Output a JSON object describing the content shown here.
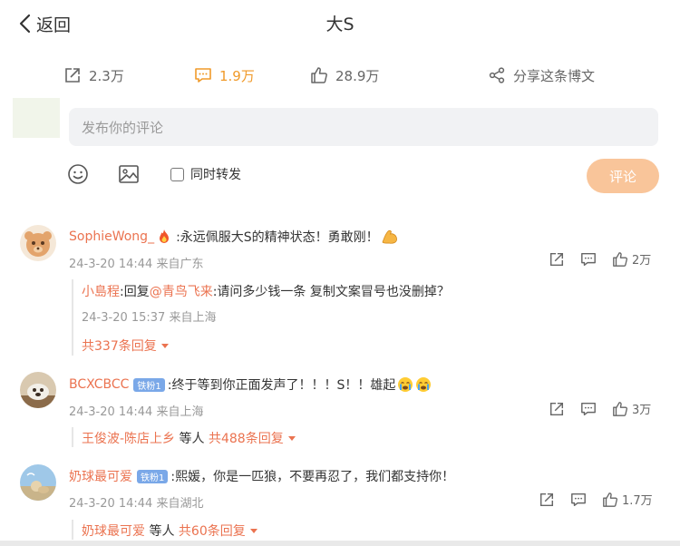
{
  "header": {
    "back_label": "返回",
    "title": "大S"
  },
  "stats": {
    "reposts": "2.3万",
    "comments": "1.9万",
    "likes": "28.9万",
    "share_label": "分享这条博文"
  },
  "composer": {
    "placeholder": "发布你的评论",
    "repost_label": "同时转发",
    "submit_label": "评论"
  },
  "comments": [
    {
      "user": "SophieWong_",
      "text": ":永远佩服大S的精神状态！勇敢刚！",
      "time": "24-3-20 14:44 来自广东",
      "likes": "2万",
      "reply": {
        "user": "小島程",
        "prefix": ":回复",
        "mention": "@青鸟飞来",
        "text": ":请问多少钱一条 复制文案冒号也没删掉？",
        "time": "24-3-20 15:37 来自上海"
      },
      "more": "共337条回复"
    },
    {
      "user": "BCXCBCC",
      "badge": "铁粉1",
      "text": ":终于等到你正面发声了！！！S！！雄起",
      "time": "24-3-20 14:44 来自上海",
      "likes": "3万",
      "more_user": "王俊波-陈店上乡",
      "more_mid": " 等人 ",
      "more": "共488条回复"
    },
    {
      "user": "奶球最可爱",
      "badge": "铁粉1",
      "text": ":熙媛，你是一匹狼，不要再忍了，我们都支持你！",
      "time": "24-3-20 14:44 来自湖北",
      "likes": "1.7万",
      "more_user": "奶球最可爱",
      "more_mid": " 等人 ",
      "more": "共60条回复"
    }
  ],
  "icons": [
    "back-chevron-icon",
    "repost-icon",
    "comment-icon",
    "like-icon",
    "share-icon",
    "emoji-icon",
    "image-icon",
    "checkbox",
    "fire-emoji-icon",
    "flex-arm-emoji-icon",
    "crying-emoji-icon"
  ],
  "colors": {
    "accent": "#eb7350",
    "active": "#f09a2a",
    "submit_bg": "#f9c59a",
    "badge": "#7aa8e8"
  }
}
